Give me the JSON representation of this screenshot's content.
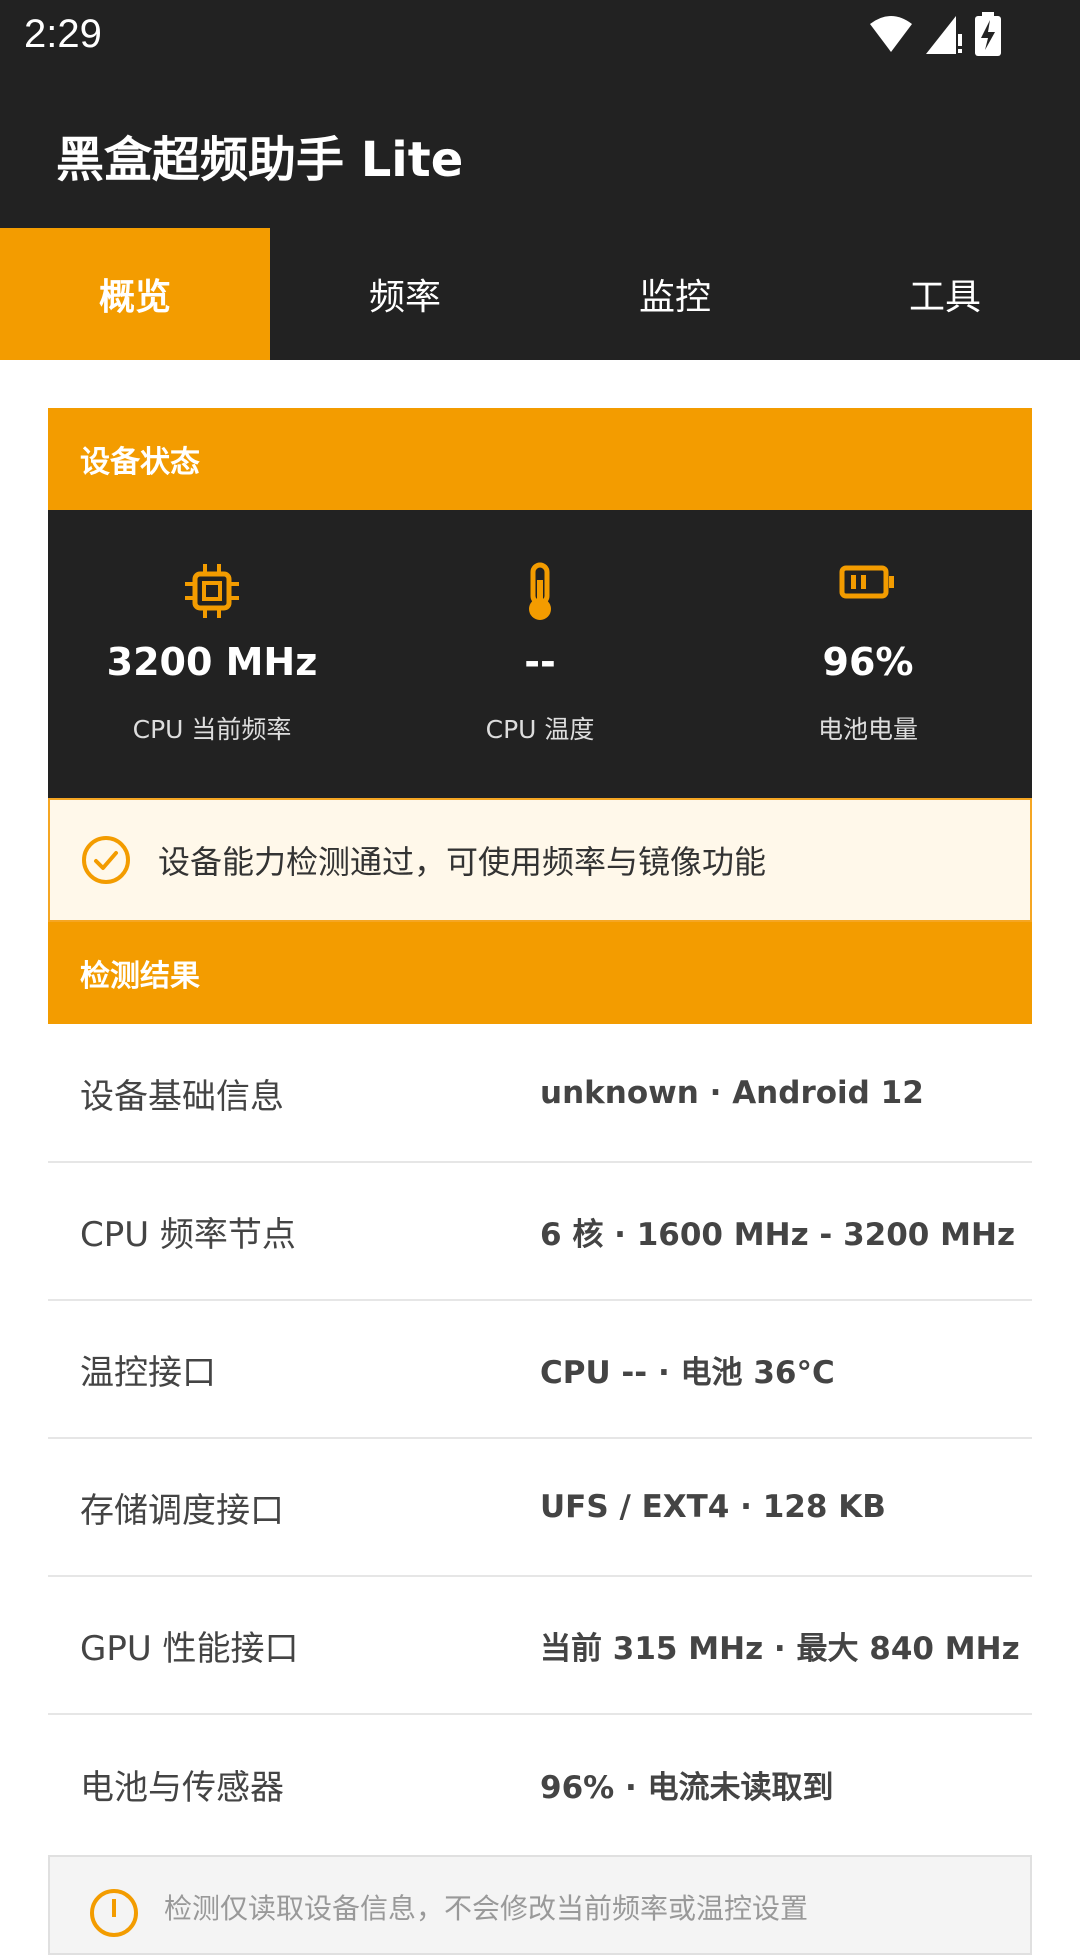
{
  "status_bar": {
    "time": "2:29"
  },
  "app": {
    "title": "黑盒超频助手 Lite"
  },
  "tabs": [
    {
      "label": "概览",
      "active": true
    },
    {
      "label": "频率",
      "active": false
    },
    {
      "label": "监控",
      "active": false
    },
    {
      "label": "工具",
      "active": false
    }
  ],
  "device_status": {
    "header": "设备状态",
    "stats": [
      {
        "icon": "cpu-chip-icon",
        "value": "3200 MHz",
        "label": "CPU 当前频率"
      },
      {
        "icon": "thermometer-icon",
        "value": "--",
        "label": "CPU 温度"
      },
      {
        "icon": "battery-icon",
        "value": "96%",
        "label": "电池电量"
      }
    ]
  },
  "capability_notice": {
    "icon": "check-circle-icon",
    "text": "设备能力检测通过，可使用频率与镜像功能"
  },
  "detection": {
    "header": "检测结果",
    "rows": [
      {
        "key": "设备基础信息",
        "value": "unknown · Android 12"
      },
      {
        "key": "CPU 频率节点",
        "value": "6 核 · 1600 MHz - 3200 MHz"
      },
      {
        "key": "温控接口",
        "value": "CPU -- · 电池 36°C"
      },
      {
        "key": "存储调度接口",
        "value": "UFS / EXT4 · 128 KB"
      },
      {
        "key": "GPU 性能接口",
        "value": "当前 315 MHz · 最大 840 MHz"
      },
      {
        "key": "电池与传感器",
        "value": "96% · 电流未读取到"
      }
    ]
  },
  "footer_notice": {
    "icon": "info-circle-icon",
    "text": "检测仅读取设备信息，不会修改当前频率或温控设置"
  },
  "colors": {
    "accent": "#f39c00",
    "dark": "#222222",
    "notice_bg": "#fff8ea"
  }
}
